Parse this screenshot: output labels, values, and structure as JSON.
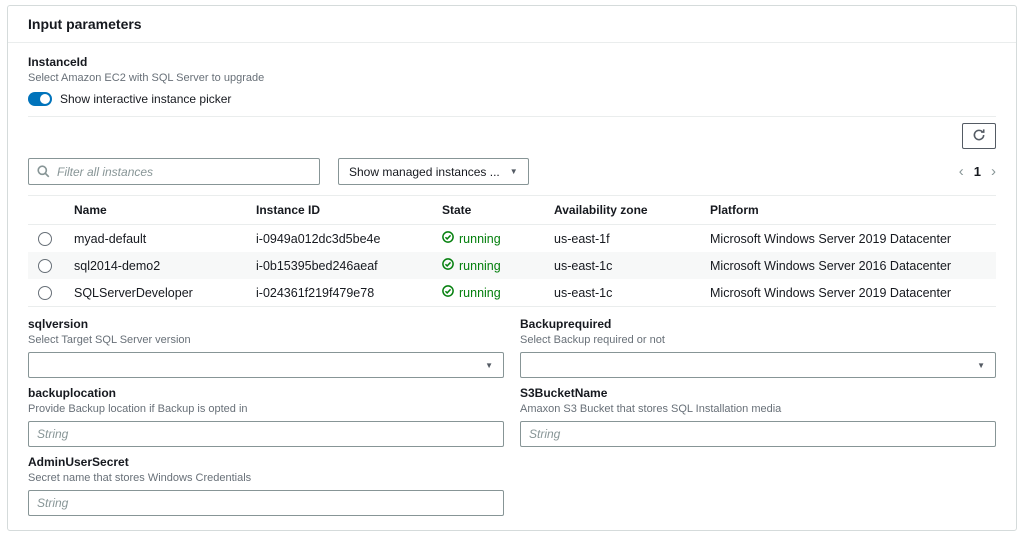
{
  "header": {
    "title": "Input parameters"
  },
  "colors": {
    "accent_blue": "#0073bb",
    "success_green": "#037f0c"
  },
  "instance_param": {
    "label": "InstanceId",
    "help": "Select Amazon EC2 with SQL Server to upgrade",
    "toggle_label": "Show interactive instance picker",
    "toggle_state": "on"
  },
  "picker": {
    "filter_placeholder": "Filter all instances",
    "dropdown_label": "Show managed instances ...",
    "pagination": {
      "prev": "‹",
      "current": "1",
      "next": "›"
    },
    "table": {
      "columns": [
        "Name",
        "Instance ID",
        "State",
        "Availability zone",
        "Platform"
      ],
      "rows": [
        {
          "name": "myad-default",
          "instance_id": "i-0949a012dc3d5be4e",
          "state": "running",
          "az": "us-east-1f",
          "platform": "Microsoft Windows Server 2019 Datacenter"
        },
        {
          "name": "sql2014-demo2",
          "instance_id": "i-0b15395bed246aeaf",
          "state": "running",
          "az": "us-east-1c",
          "platform": "Microsoft Windows Server 2016 Datacenter"
        },
        {
          "name": "SQLServerDeveloper",
          "instance_id": "i-024361f219f479e78",
          "state": "running",
          "az": "us-east-1c",
          "platform": "Microsoft Windows Server 2019 Datacenter"
        }
      ]
    }
  },
  "form": {
    "fields": [
      {
        "label": "sqlversion",
        "help": "Select Target SQL Server version",
        "type": "select"
      },
      {
        "label": "Backuprequired",
        "help": "Select Backup required or not",
        "type": "select"
      },
      {
        "label": "backuplocation",
        "help": "Provide Backup location if Backup is opted in",
        "type": "text",
        "placeholder": "String",
        "value": ""
      },
      {
        "label": "S3BucketName",
        "help": "Amaxon S3 Bucket that stores SQL Installation media",
        "type": "text",
        "placeholder": "String",
        "value": ""
      },
      {
        "label": "AdminUserSecret",
        "help": "Secret name that stores Windows Credentials",
        "type": "text",
        "placeholder": "String",
        "value": ""
      }
    ]
  }
}
